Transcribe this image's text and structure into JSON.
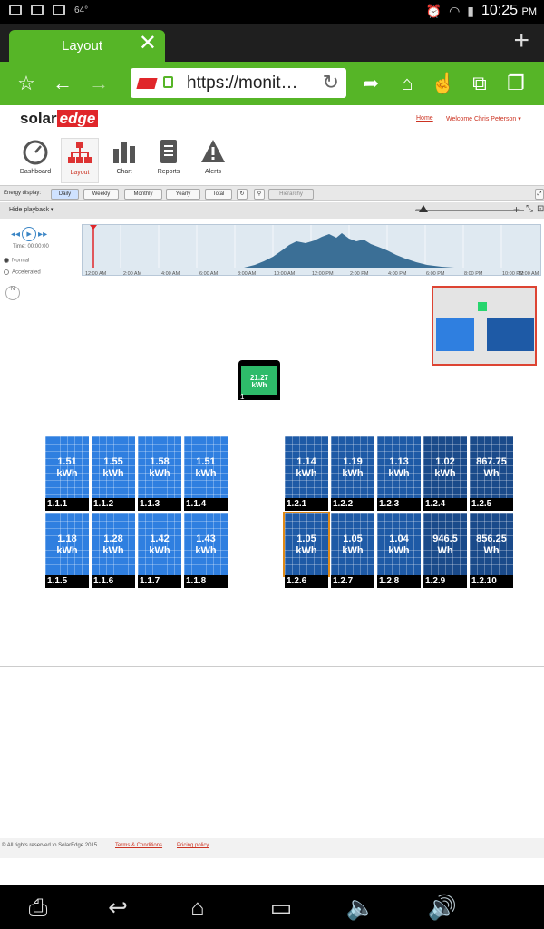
{
  "status_bar": {
    "temperature": "64°",
    "time": "10:25",
    "ampm": "PM"
  },
  "browser": {
    "tab_title": "Layout",
    "url": "https://monit…"
  },
  "site": {
    "logo_solar": "solar",
    "logo_edge": "edge",
    "home_link": "Home",
    "welcome": "Welcome Chris Peterson ▾"
  },
  "nav": [
    {
      "label": "Dashboard",
      "icon": "gauge-icon"
    },
    {
      "label": "Layout",
      "icon": "layout-tree-icon"
    },
    {
      "label": "Chart",
      "icon": "bar-chart-icon"
    },
    {
      "label": "Reports",
      "icon": "notebook-icon"
    },
    {
      "label": "Alerts",
      "icon": "warning-icon"
    }
  ],
  "energy_display": {
    "label": "Energy display:",
    "buttons": [
      "Daily",
      "Weekly",
      "Monthly",
      "Yearly",
      "Total"
    ],
    "selected": "Daily",
    "hierarchy": "Hierarchy"
  },
  "playback": {
    "hide_label": "Hide playback ▾",
    "time_label": "Time: 00:00:00",
    "modes": [
      "Normal",
      "Accelerated"
    ],
    "selected_mode": "Normal",
    "time_ticks": [
      "12:00 AM",
      "2:00 AM",
      "4:00 AM",
      "6:00 AM",
      "8:00 AM",
      "10:00 AM",
      "12:00 PM",
      "2:00 PM",
      "4:00 PM",
      "6:00 PM",
      "8:00 PM",
      "10:00 PM",
      "12:00 AM"
    ]
  },
  "compass": "N",
  "inverter": {
    "value": "21.27",
    "unit": "kWh",
    "id": "1"
  },
  "panels": [
    {
      "id": "1.1.1",
      "value": "1.51",
      "unit": "kWh"
    },
    {
      "id": "1.1.2",
      "value": "1.55",
      "unit": "kWh"
    },
    {
      "id": "1.1.3",
      "value": "1.58",
      "unit": "kWh"
    },
    {
      "id": "1.1.4",
      "value": "1.51",
      "unit": "kWh"
    },
    {
      "id": "1.1.5",
      "value": "1.18",
      "unit": "kWh"
    },
    {
      "id": "1.1.6",
      "value": "1.28",
      "unit": "kWh"
    },
    {
      "id": "1.1.7",
      "value": "1.42",
      "unit": "kWh"
    },
    {
      "id": "1.1.8",
      "value": "1.43",
      "unit": "kWh"
    },
    {
      "id": "1.2.1",
      "value": "1.14",
      "unit": "kWh"
    },
    {
      "id": "1.2.2",
      "value": "1.19",
      "unit": "kWh"
    },
    {
      "id": "1.2.3",
      "value": "1.13",
      "unit": "kWh"
    },
    {
      "id": "1.2.4",
      "value": "1.02",
      "unit": "kWh"
    },
    {
      "id": "1.2.5",
      "value": "867.75",
      "unit": "Wh"
    },
    {
      "id": "1.2.6",
      "value": "1.05",
      "unit": "kWh"
    },
    {
      "id": "1.2.7",
      "value": "1.05",
      "unit": "kWh"
    },
    {
      "id": "1.2.8",
      "value": "1.04",
      "unit": "kWh"
    },
    {
      "id": "1.2.9",
      "value": "946.5",
      "unit": "Wh"
    },
    {
      "id": "1.2.10",
      "value": "856.25",
      "unit": "Wh"
    }
  ],
  "footer": {
    "copyright": "© All rights reserved to SolarEdge 2015",
    "terms": "Terms & Conditions",
    "privacy": "Pricing policy"
  },
  "colors": {
    "brand_green": "#56b527",
    "panel_blue": "#2f7fe0",
    "selected_outline": "#e08a16",
    "inverter_green": "#2ebb6a"
  }
}
